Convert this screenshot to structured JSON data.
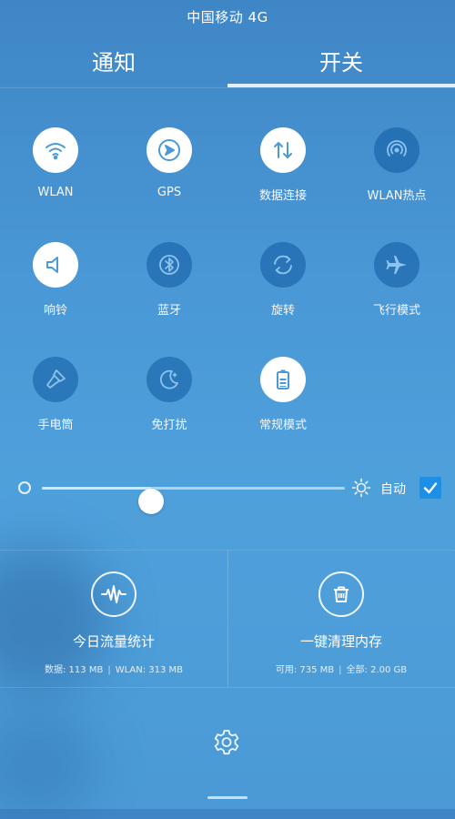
{
  "status_bar": {
    "carrier": "中国移动 4G"
  },
  "tabs": [
    {
      "label": "通知",
      "active": false
    },
    {
      "label": "开关",
      "active": true
    }
  ],
  "toggles": [
    {
      "label": "WLAN",
      "icon": "wifi-icon",
      "on": true
    },
    {
      "label": "GPS",
      "icon": "gps-icon",
      "on": true
    },
    {
      "label": "数据连接",
      "icon": "data-connection-icon",
      "on": true
    },
    {
      "label": "WLAN热点",
      "icon": "hotspot-icon",
      "on": false
    },
    {
      "label": "响铃",
      "icon": "speaker-icon",
      "on": true
    },
    {
      "label": "蓝牙",
      "icon": "bluetooth-icon",
      "on": false
    },
    {
      "label": "旋转",
      "icon": "rotation-icon",
      "on": false
    },
    {
      "label": "飞行模式",
      "icon": "airplane-icon",
      "on": false
    },
    {
      "label": "手电筒",
      "icon": "flashlight-icon",
      "on": false
    },
    {
      "label": "免打扰",
      "icon": "moon-icon",
      "on": false
    },
    {
      "label": "常规模式",
      "icon": "battery-icon",
      "on": true
    }
  ],
  "brightness": {
    "level": 0.36,
    "auto_label": "自动",
    "auto_checked": true
  },
  "cards": {
    "traffic": {
      "title": "今日流量统计",
      "data_label": "数据: 113 MB",
      "wlan_label": "WLAN: 313 MB",
      "separator": "|"
    },
    "memory": {
      "title": "一键清理内存",
      "available_label": "可用: 735 MB",
      "total_label": "全部: 2.00 GB",
      "separator": "|"
    }
  },
  "colors": {
    "on_circle": "#ffffff",
    "on_icon": "#4a9ad7",
    "off_circle": "#1a66ac",
    "accent": "#1f8fe6"
  }
}
